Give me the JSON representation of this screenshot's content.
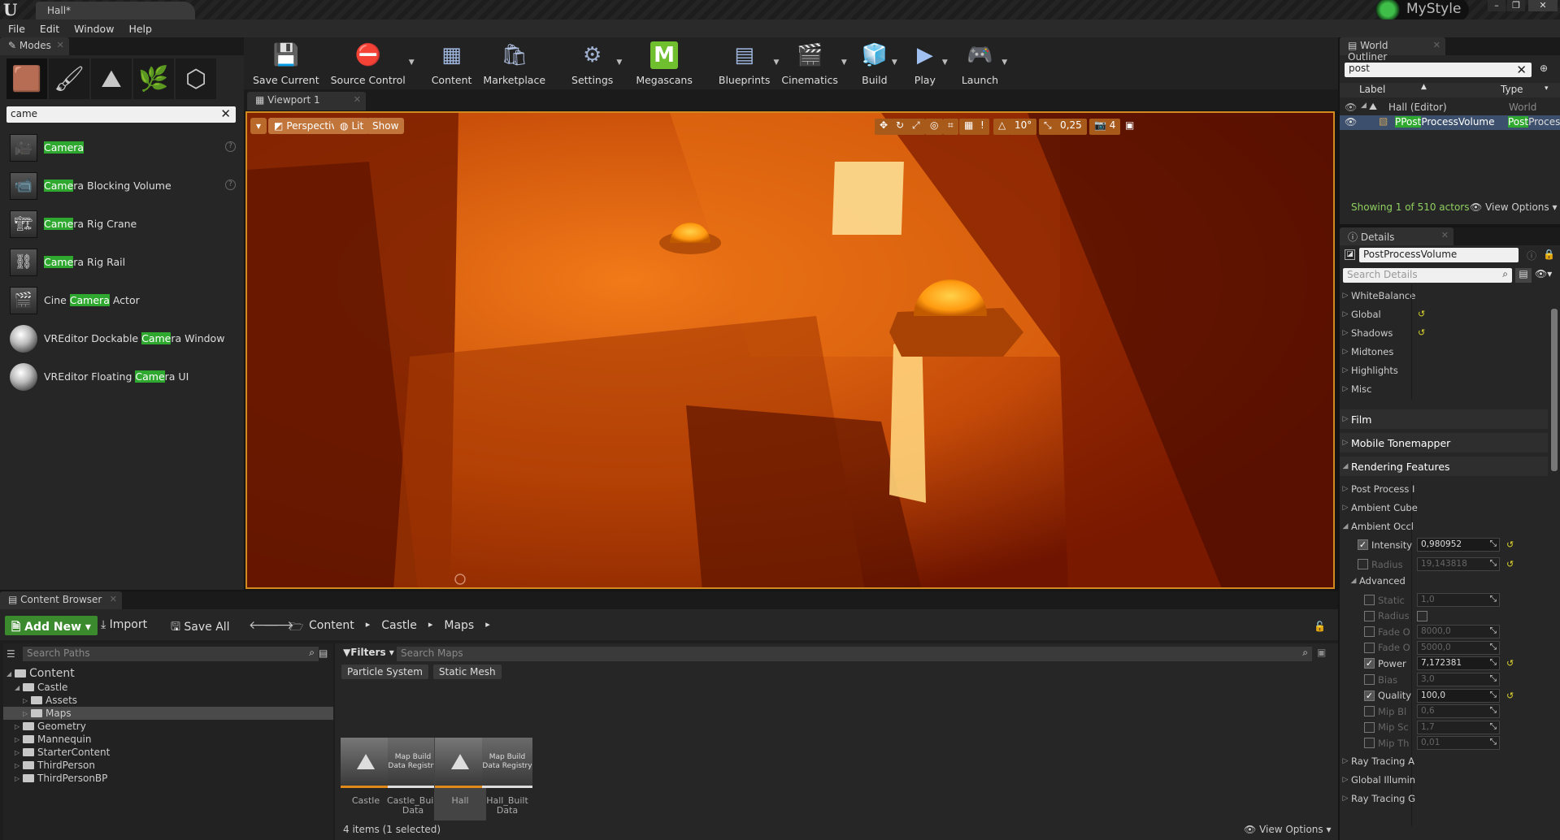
{
  "window": {
    "doc_tab": "Hall*",
    "profile": "MyStyle"
  },
  "menu": [
    "File",
    "Edit",
    "Window",
    "Help"
  ],
  "modes": {
    "tab": "Modes",
    "search_value": "came",
    "items": [
      {
        "pre": "",
        "match": "Camera",
        "post": "",
        "help": true
      },
      {
        "pre": "",
        "match": "Came",
        "post": "ra Blocking Volume",
        "help": true
      },
      {
        "pre": "",
        "match": "Came",
        "post": "ra Rig Crane",
        "help": false
      },
      {
        "pre": "",
        "match": "Came",
        "post": "ra Rig Rail",
        "help": false
      },
      {
        "pre": "Cine ",
        "match": "Camera",
        "post": " Actor",
        "help": false
      },
      {
        "pre": "VREditor Dockable ",
        "match": "Came",
        "post": "ra Window",
        "help": false
      },
      {
        "pre": "VREditor Floating ",
        "match": "Came",
        "post": "ra UI",
        "help": false
      }
    ]
  },
  "toolbar": {
    "buttons": [
      {
        "label": "Save Current",
        "icon": "save-icon",
        "color": "#d8d8d8",
        "dd": false
      },
      {
        "label": "Source Control",
        "icon": "source-control-icon",
        "color": "#c06060",
        "dd": true
      },
      {
        "label": "Content",
        "icon": "content-icon",
        "color": "#a0b8e0",
        "dd": false
      },
      {
        "label": "Marketplace",
        "icon": "marketplace-icon",
        "color": "#b0c0e0",
        "dd": false
      },
      {
        "label": "Settings",
        "icon": "settings-icon",
        "color": "#a0b0d0",
        "dd": true
      },
      {
        "label": "Megascans",
        "icon": "megascans-icon",
        "color": "#6fbf2f",
        "dd": false
      },
      {
        "label": "Blueprints",
        "icon": "blueprints-icon",
        "color": "#a0b8e0",
        "dd": true
      },
      {
        "label": "Cinematics",
        "icon": "cinematics-icon",
        "color": "#b0c0e0",
        "dd": true
      },
      {
        "label": "Build",
        "icon": "build-icon",
        "color": "#a0b8e0",
        "dd": true
      },
      {
        "label": "Play",
        "icon": "play-icon",
        "color": "#9fc0f0",
        "dd": true
      },
      {
        "label": "Launch",
        "icon": "launch-icon",
        "color": "#b0c0e0",
        "dd": true
      }
    ]
  },
  "viewport": {
    "tab": "Viewport 1",
    "perspective": "Perspective",
    "lit": "Lit",
    "show": "Show",
    "angle": "10°",
    "scale": "0,25",
    "cam_speed": "4"
  },
  "outliner": {
    "tab": "World Outliner",
    "search_value": "post",
    "col_label": "Label",
    "col_type": "Type",
    "rows": [
      {
        "label": "Hall (Editor)",
        "type": "World"
      },
      {
        "label_match": "PPost",
        "label_rest": "ProcessVolume",
        "type_match": "Post",
        "type_rest": "Process"
      }
    ],
    "status": "Showing 1 of 510 actors",
    "view_options": "View Options"
  },
  "details": {
    "tab": "Details",
    "name_value": "PostProcessVolume",
    "search_placeholder": "Search Details",
    "groups_a": [
      "WhiteBalance",
      "Global",
      "Shadows",
      "Midtones",
      "Highlights",
      "Misc"
    ],
    "groups_a_reset": [
      false,
      true,
      true,
      false,
      false,
      false
    ],
    "sections": [
      "Film",
      "Mobile Tonemapper",
      "Rendering Features"
    ],
    "groups_b": [
      "Post Process I",
      "Ambient Cube",
      "Ambient Occl"
    ],
    "props": [
      {
        "label": "Intensity",
        "value": "0,980952",
        "checked": true,
        "enabled": true,
        "reset": true
      },
      {
        "label": "Radius",
        "value": "19,143818",
        "checked": false,
        "enabled": false,
        "reset": true
      }
    ],
    "advanced_label": "Advanced",
    "adv_props": [
      {
        "label": "Static",
        "value": "1,0",
        "checked": false,
        "enabled": false,
        "reset": false,
        "input": true
      },
      {
        "label": "Radius",
        "value": "",
        "checked": false,
        "enabled": false,
        "reset": false,
        "input": false
      },
      {
        "label": "Fade O",
        "value": "8000,0",
        "checked": false,
        "enabled": false,
        "reset": false,
        "input": true
      },
      {
        "label": "Fade O",
        "value": "5000,0",
        "checked": false,
        "enabled": false,
        "reset": false,
        "input": true
      },
      {
        "label": "Power",
        "value": "7,172381",
        "checked": true,
        "enabled": true,
        "reset": true,
        "input": true
      },
      {
        "label": "Bias",
        "value": "3,0",
        "checked": false,
        "enabled": false,
        "reset": false,
        "input": true
      },
      {
        "label": "Quality",
        "value": "100,0",
        "checked": true,
        "enabled": true,
        "reset": true,
        "input": true
      },
      {
        "label": "Mip Bl",
        "value": "0,6",
        "checked": false,
        "enabled": false,
        "reset": false,
        "input": true
      },
      {
        "label": "Mip Sc",
        "value": "1,7",
        "checked": false,
        "enabled": false,
        "reset": false,
        "input": true
      },
      {
        "label": "Mip Th",
        "value": "0,01",
        "checked": false,
        "enabled": false,
        "reset": false,
        "input": true
      }
    ],
    "groups_c": [
      "Ray Tracing A",
      "Global Illumin",
      "Ray Tracing G"
    ]
  },
  "content_browser": {
    "tab": "Content Browser",
    "add_new": "Add New",
    "import": "Import",
    "save_all": "Save All",
    "breadcrumb": [
      "Content",
      "Castle",
      "Maps"
    ],
    "search_paths_placeholder": "Search Paths",
    "filters": "Filters",
    "search_maps_placeholder": "Search Maps",
    "filter_chips": [
      "Particle System",
      "Static Mesh"
    ],
    "tree": [
      {
        "label": "Content",
        "depth": 0,
        "open": true,
        "root": true
      },
      {
        "label": "Castle",
        "depth": 1,
        "open": true
      },
      {
        "label": "Assets",
        "depth": 2,
        "open": false
      },
      {
        "label": "Maps",
        "depth": 2,
        "open": false,
        "selected": true
      },
      {
        "label": "Geometry",
        "depth": 1,
        "open": false
      },
      {
        "label": "Mannequin",
        "depth": 1,
        "open": false
      },
      {
        "label": "StarterContent",
        "depth": 1,
        "open": false
      },
      {
        "label": "ThirdPerson",
        "depth": 1,
        "open": false
      },
      {
        "label": "ThirdPersonBP",
        "depth": 1,
        "open": false
      }
    ],
    "assets": [
      {
        "name": "Castle",
        "thumb": "",
        "kind": "map"
      },
      {
        "name": "Castle_Built Data",
        "thumb": "Map Build Data Registry",
        "kind": "data"
      },
      {
        "name": "Hall",
        "thumb": "",
        "kind": "map",
        "selected": true
      },
      {
        "name": "Hall_Built Data",
        "thumb": "Map Build Data Registry",
        "kind": "data"
      }
    ],
    "status": "4 items (1 selected)",
    "view_options": "View Options"
  }
}
